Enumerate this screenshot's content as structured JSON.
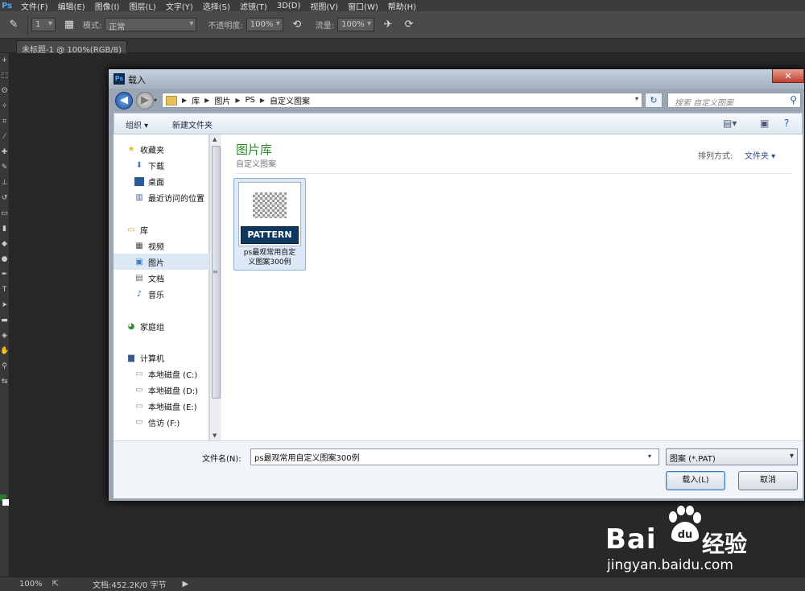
{
  "app": {
    "logo": "Ps",
    "menu": [
      "文件(F)",
      "编辑(E)",
      "图像(I)",
      "图层(L)",
      "文字(Y)",
      "选择(S)",
      "滤镜(T)",
      "3D(D)",
      "视图(V)",
      "窗口(W)",
      "帮助(H)"
    ]
  },
  "options": {
    "mode_label": "模式:",
    "mode_value": "正常",
    "opacity_label": "不透明度:",
    "opacity_value": "100%",
    "flow_label": "流量:",
    "flow_value": "100%",
    "brush_size": "1"
  },
  "document_tab": "未标题-1 @ 100%(RGB/8)",
  "status": {
    "zoom": "100%",
    "doc_info": "文档:452.2K/0 字节"
  },
  "dialog": {
    "title": "载入",
    "breadcrumb": [
      "库",
      "图片",
      "PS",
      "自定义图案"
    ],
    "search_placeholder": "搜索 自定义图案",
    "commands": {
      "organize": "组织 ▾",
      "new_folder": "新建文件夹"
    },
    "nav": {
      "favorites": "收藏夹",
      "downloads": "下载",
      "desktop": "桌面",
      "recent": "最近访问的位置",
      "libraries": "库",
      "videos": "视频",
      "pictures": "图片",
      "documents": "文档",
      "music": "音乐",
      "homegroup": "家庭组",
      "computer": "计算机",
      "drive_c": "本地磁盘 (C:)",
      "drive_d": "本地磁盘 (D:)",
      "drive_e": "本地磁盘 (E:)",
      "drive_f": "信访 (F:)"
    },
    "content": {
      "heading": "图片库",
      "subheading": "自定义图案",
      "arrange_label": "排列方式:",
      "arrange_value": "文件夹 ▾",
      "file": {
        "banner": "PATTERN",
        "name_line1": "ps最观常用自定",
        "name_line2": "义图案300例"
      }
    },
    "filename_label": "文件名(N):",
    "filename_value": "ps最观常用自定义图案300例",
    "filetype": "图案 (*.PAT)",
    "load_button": "载入(L)",
    "cancel_button": "取消"
  },
  "watermark": {
    "brand_left": "Bai",
    "brand_right": "经验",
    "url": "jingyan.baidu.com"
  }
}
